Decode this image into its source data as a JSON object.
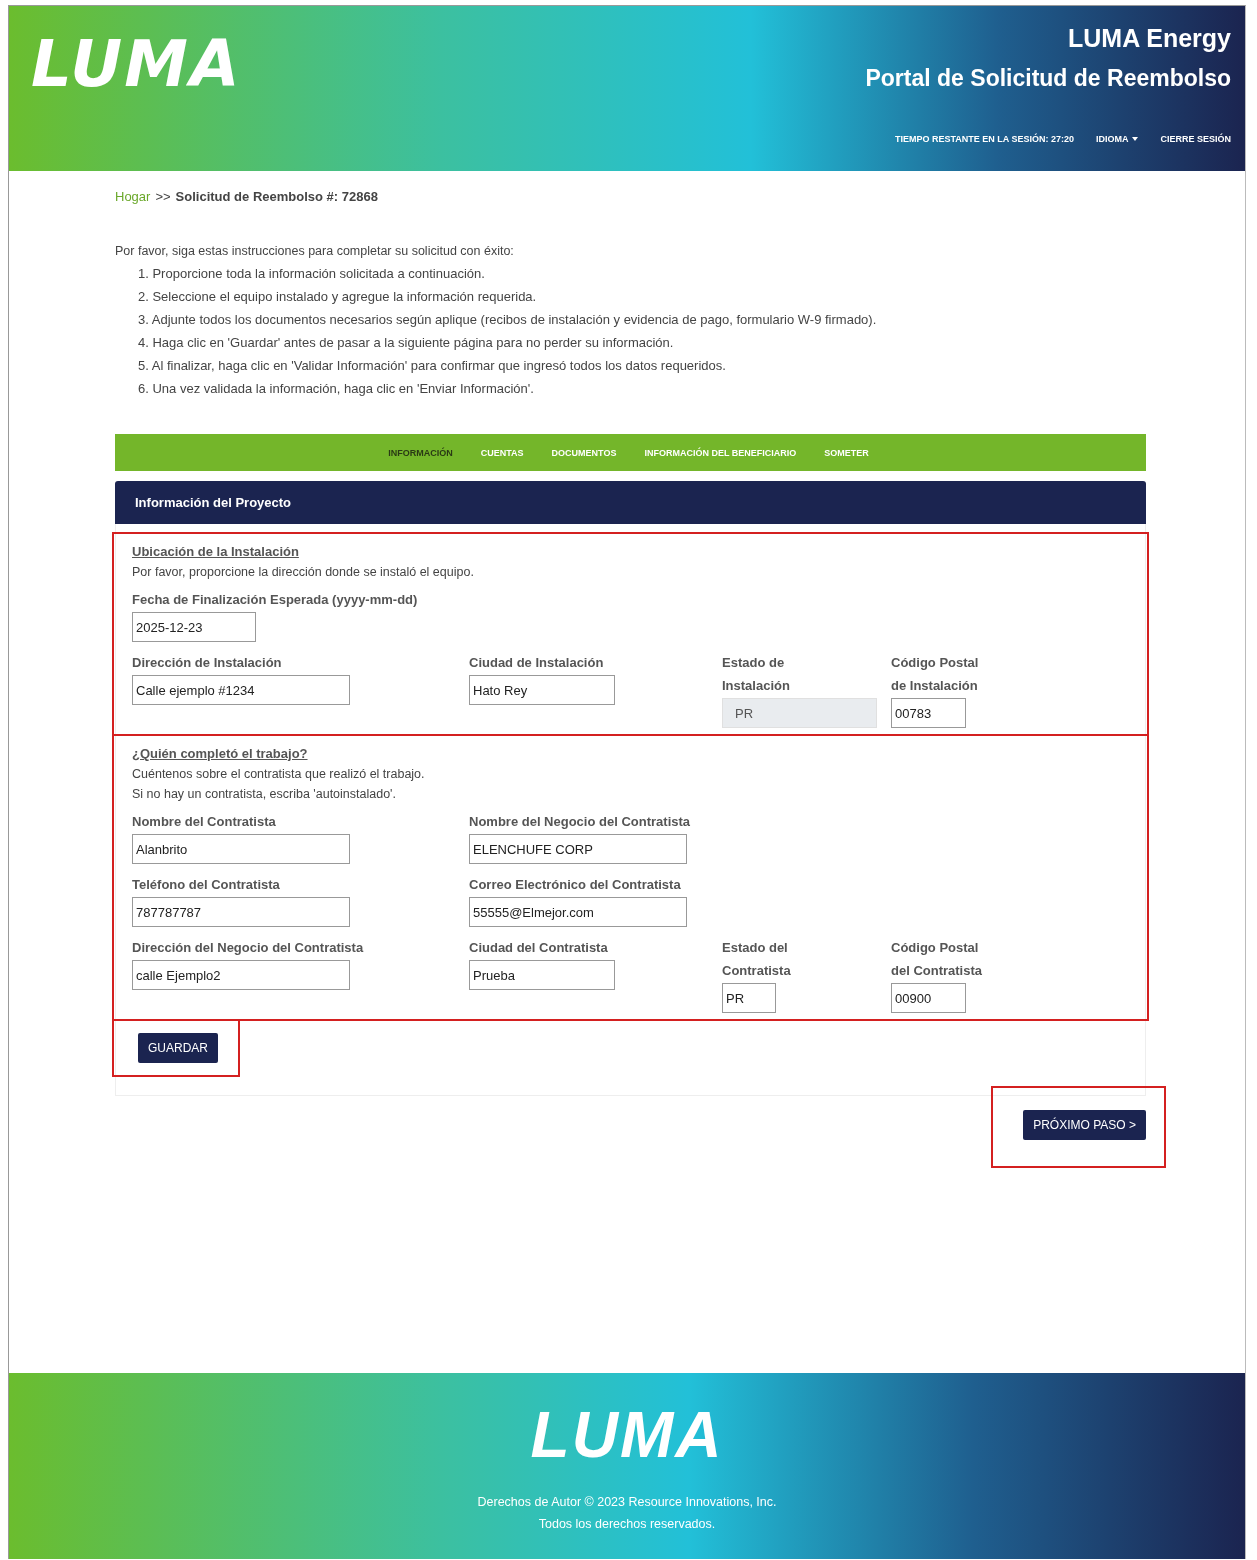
{
  "header": {
    "logo": "LUMA",
    "company": "LUMA Energy",
    "portal_title": "Portal de Solicitud de Reembolso",
    "nav": [
      {
        "kind": "text",
        "label": "TIEMPO RESTANTE EN LA SESIÓN: 27:20"
      },
      {
        "kind": "dropdown",
        "label": "IDIOMA"
      },
      {
        "kind": "link",
        "label": "CIERRE SESIÓN"
      }
    ]
  },
  "breadcrumb": {
    "home": "Hogar",
    "separator": ">>",
    "current": "Solicitud de Reembolso #: 72868"
  },
  "instructions": {
    "intro": "Por favor, siga estas instrucciones para completar su solicitud con éxito:",
    "steps": [
      "1. Proporcione toda la información solicitada a continuación.",
      "2. Seleccione el equipo instalado y agregue la información requerida.",
      "3. Adjunte todos los documentos necesarios según aplique (recibos de instalación y evidencia de pago, formulario W-9 firmado).",
      "4. Haga clic en 'Guardar' antes de pasar a la siguiente página para no perder su información.",
      "5. Al finalizar, haga clic en 'Validar Información' para confirmar que ingresó todos los datos requeridos.",
      "6. Una vez validada la información, haga clic en 'Enviar Información'."
    ]
  },
  "tabs": [
    {
      "label": "INFORMACIÓN",
      "selected": true
    },
    {
      "label": "CUENTAS",
      "selected": false
    },
    {
      "label": "DOCUMENTOS",
      "selected": false
    },
    {
      "label": "INFORMACIÓN DEL BENEFICIARIO",
      "selected": false
    },
    {
      "label": "SOMETER",
      "selected": false
    }
  ],
  "panel": {
    "title": "Información del Proyecto",
    "sections": [
      {
        "heading": "Ubicación de la Instalación",
        "highlighted": true,
        "notes": [
          "Por favor, proporcione la dirección donde se instaló el equipo."
        ],
        "rows": [
          [
            {
              "label": "Fecha de Finalización Esperada (yyyy-mm-dd)",
              "value": "2025-12-23",
              "disabled": false
            }
          ],
          [
            {
              "label": "Dirección de Instalación",
              "value": "Calle ejemplo #1234",
              "disabled": false
            },
            {
              "label": "Ciudad de Instalación",
              "value": "Hato Rey",
              "disabled": false
            },
            {
              "label": "Estado de Instalación",
              "value": "PR",
              "disabled": true
            },
            {
              "label": "Código Postal de Instalación",
              "value": "00783",
              "disabled": false
            }
          ]
        ]
      },
      {
        "heading": "¿Quién completó el trabajo?",
        "highlighted": true,
        "notes": [
          "Cuéntenos sobre el contratista que realizó el trabajo.",
          "Si no hay un contratista, escriba 'autoinstalado'."
        ],
        "rows": [
          [
            {
              "label": "Nombre del Contratista",
              "value": "Alanbrito",
              "disabled": false
            },
            {
              "label": "Nombre del Negocio del Contratista",
              "value": "ELENCHUFE CORP",
              "disabled": false
            }
          ],
          [
            {
              "label": "Teléfono del Contratista",
              "value": "787787787",
              "disabled": false
            },
            {
              "label": "Correo Electrónico del Contratista",
              "value": "55555@Elmejor.com",
              "disabled": false
            }
          ],
          [
            {
              "label": "Dirección del Negocio del Contratista",
              "value": "calle Ejemplo2",
              "disabled": false
            },
            {
              "label": "Ciudad del Contratista",
              "value": "Prueba",
              "disabled": false
            },
            {
              "label": "Estado del Contratista",
              "value": "PR",
              "disabled": false
            },
            {
              "label": "Código Postal del Contratista",
              "value": "00900",
              "disabled": false
            }
          ]
        ]
      }
    ],
    "save": {
      "label": "GUARDAR",
      "highlighted": true
    }
  },
  "next": {
    "label": "PRÓXIMO PASO >",
    "highlighted": true
  },
  "footer": {
    "logo": "LUMA",
    "copyright": "Derechos de Autor © 2023 Resource Innovations, Inc.",
    "rights": "Todos los derechos reservados."
  }
}
